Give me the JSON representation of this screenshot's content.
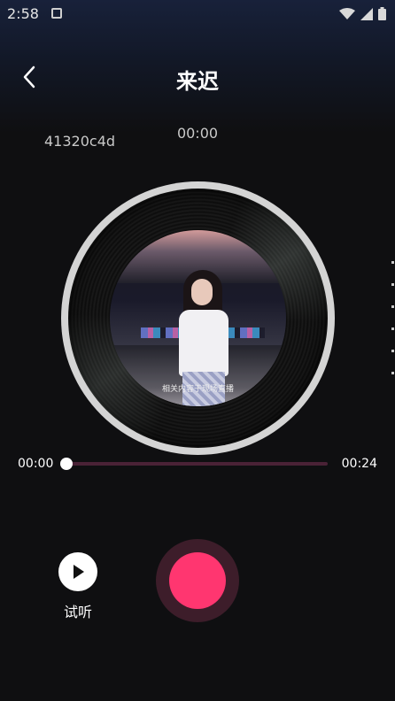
{
  "status_bar": {
    "time": "2:58",
    "icons": [
      "notification-icon",
      "wifi-icon",
      "signal-icon",
      "battery-icon"
    ]
  },
  "header": {
    "title": "来迟",
    "back_icon": "chevron-left-icon"
  },
  "track_info": {
    "id": "41320c4d",
    "elapsed": "00:00"
  },
  "cover": {
    "subtitle": "相关内容于现场直播"
  },
  "progress": {
    "current": "00:00",
    "total": "00:24",
    "fraction": 0.0
  },
  "controls": {
    "preview_label": "试听",
    "preview_icon": "play-icon",
    "record_icon": "record-button-icon"
  },
  "colors": {
    "accent": "#ff3670",
    "accent_dark": "#3d1d2a",
    "track_bg": "#4a2236",
    "background": "#0f0f11"
  }
}
